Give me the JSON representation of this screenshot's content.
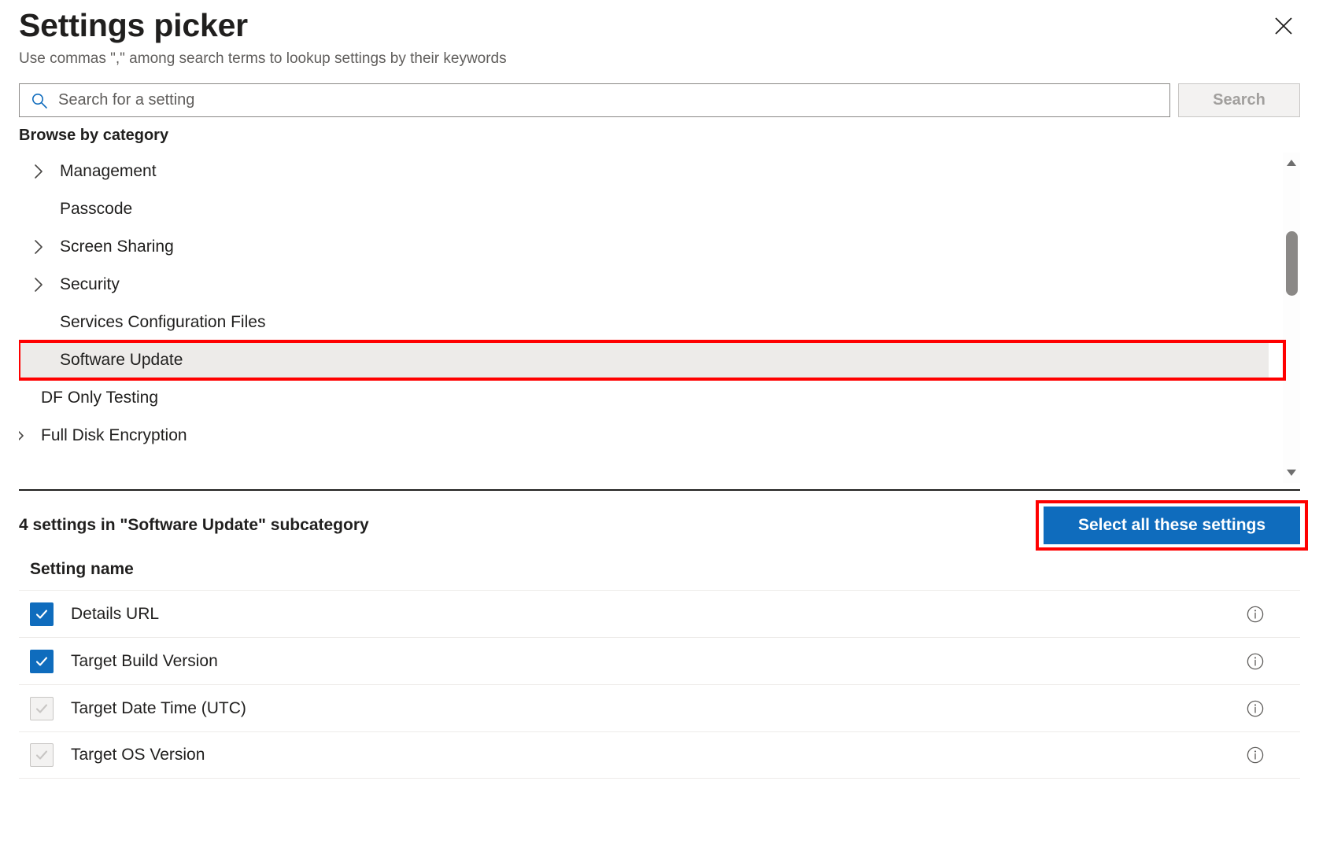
{
  "header": {
    "title": "Settings picker",
    "subtitle": "Use commas \",\" among search terms to lookup settings by their keywords",
    "close_icon": "close-icon"
  },
  "search": {
    "placeholder": "Search for a setting",
    "value": "",
    "button_label": "Search",
    "icon": "search-icon"
  },
  "browse": {
    "label": "Browse by category",
    "items": [
      {
        "label": "Management",
        "expandable": true,
        "level": 1,
        "selected": false
      },
      {
        "label": "Passcode",
        "expandable": false,
        "level": 1,
        "selected": false
      },
      {
        "label": "Screen Sharing",
        "expandable": true,
        "level": 1,
        "selected": false
      },
      {
        "label": "Security",
        "expandable": true,
        "level": 1,
        "selected": false
      },
      {
        "label": "Services Configuration Files",
        "expandable": false,
        "level": 1,
        "selected": false
      },
      {
        "label": "Software Update",
        "expandable": false,
        "level": 1,
        "selected": true
      },
      {
        "label": "DF Only Testing",
        "expandable": false,
        "level": 0,
        "selected": false
      },
      {
        "label": "Full Disk Encryption",
        "expandable": true,
        "level": 0,
        "selected": false
      }
    ],
    "scrollbar": {
      "up_arrow_icon": "triangle-up-icon",
      "down_arrow_icon": "triangle-down-icon",
      "thumb_icon": "scrollbar-thumb"
    }
  },
  "results": {
    "count_text": "4 settings in \"Software Update\" subcategory",
    "select_all_label": "Select all these settings",
    "column_header": "Setting name",
    "rows": [
      {
        "name": "Details URL",
        "checked": true,
        "disabled": false,
        "info_icon": "info-icon"
      },
      {
        "name": "Target Build Version",
        "checked": true,
        "disabled": false,
        "info_icon": "info-icon"
      },
      {
        "name": "Target Date Time (UTC)",
        "checked": false,
        "disabled": true,
        "info_icon": "info-icon"
      },
      {
        "name": "Target OS Version",
        "checked": false,
        "disabled": true,
        "info_icon": "info-icon"
      }
    ]
  },
  "colors": {
    "accent": "#0f6cbd",
    "highlight_border": "#ff0000",
    "selected_row_bg": "#edebe9",
    "muted_text": "#605e5c"
  }
}
